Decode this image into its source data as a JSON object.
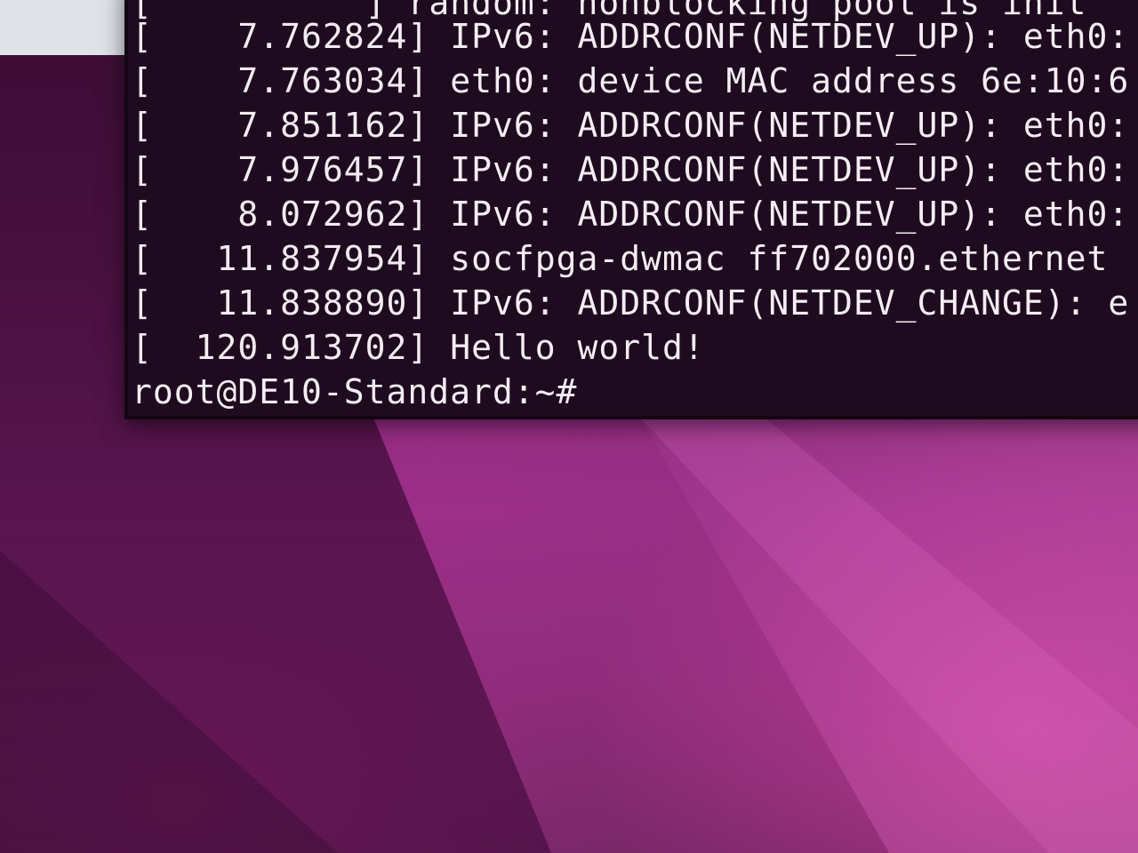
{
  "desktop": {
    "background_color": "#5e1753",
    "accent_color": "#e446aa"
  },
  "terminal": {
    "background_color": "#1f0b1f",
    "text_color": "#efe7ee",
    "partial_top_line": {
      "timestamp": "[          ]",
      "message": "random: nonblocking pool is init"
    },
    "lines": [
      {
        "timestamp": "[    7.762824]",
        "message": "IPv6: ADDRCONF(NETDEV_UP): eth0:"
      },
      {
        "timestamp": "[    7.763034]",
        "message": "eth0: device MAC address 6e:10:6"
      },
      {
        "timestamp": "[    7.851162]",
        "message": "IPv6: ADDRCONF(NETDEV_UP): eth0:"
      },
      {
        "timestamp": "[    7.976457]",
        "message": "IPv6: ADDRCONF(NETDEV_UP): eth0:"
      },
      {
        "timestamp": "[    8.072962]",
        "message": "IPv6: ADDRCONF(NETDEV_UP): eth0:"
      },
      {
        "timestamp": "[   11.837954]",
        "message": "socfpga-dwmac ff702000.ethernet"
      },
      {
        "timestamp": "[   11.838890]",
        "message": "IPv6: ADDRCONF(NETDEV_CHANGE): e"
      },
      {
        "timestamp": "[  120.913702]",
        "message": "Hello world!"
      }
    ],
    "prompt": "root@DE10-Standard:~#"
  }
}
